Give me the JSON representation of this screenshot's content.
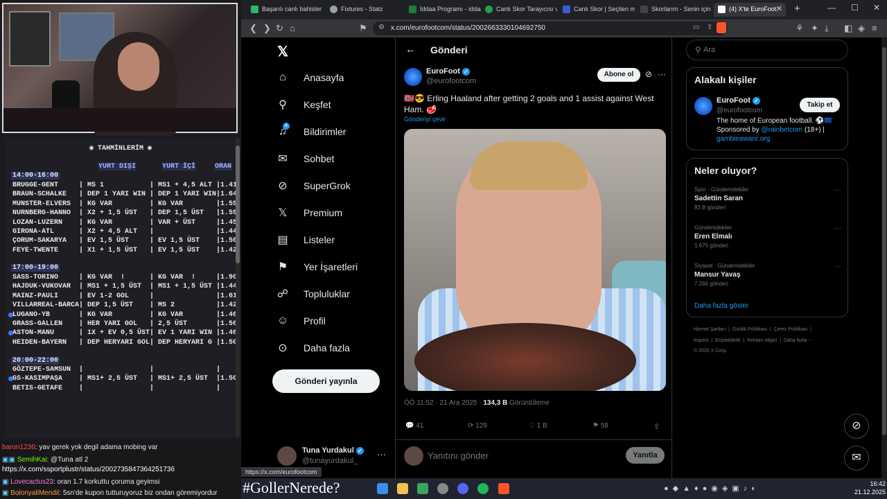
{
  "stream": {
    "panel_title": "TAHMİNLERİM",
    "col_yurt_disi": "YURT DIŞI",
    "col_yurt_ici": "YURT İÇİ",
    "col_oran": "ORAN",
    "slot1": "14:00-16:00",
    "slot2": "17:00-19:00",
    "slot3": "20:00-22:00",
    "rows1": [
      "BRUGGE-GENT     | MS 1           | MS1 + 4,5 ALT |1.41",
      "BRAUN-SCHALKE   | DEP 1 YARI WIN | DEP 1 YARI WIN|1.64",
      "MUNSTER-ELVERS  | KG VAR         | KG VAR        |1.59",
      "NURNBERG-HANNO  | X2 + 1,5 ÜST   | DEP 1,5 ÜST   |1.59",
      "LOZAN-LUZERN    | KG VAR         | VAR + ÜST     |1.45",
      "GIRONA-ATL      | X2 + 4,5 ALT   |               |1.44",
      "ÇORUM-SAKARYA   | EV 1,5 ÜST     | EV 1,5 ÜST    |1.50",
      "FEYE-TWENTE     | X1 + 1,5 ÜST   | EV 1,5 ÜST    |1.42"
    ],
    "rows2": [
      "SASS-TORINO     | KG VAR  !      | KG VAR  !     |1.90",
      "HAJDUK-VUKOVAR  | MS1 + 1,5 ÜST  | MS1 + 1,5 ÜST |1.44",
      "MAINZ-PAULI     | EV 1-2 GOL     |               |1.61",
      "VILLARREAL-BARCA| DEP 1,5 ÜST    | MS 2          |1.42",
      "LUGANO-YB       | KG VAR         | KG VAR        |1.46",
      "GRASS-GALLEN    | HER YARI GOL   | 2,5 ÜST       |1.56",
      "ASTON-MANU      | 1X + EV 0,5 ÜST| EV 1 YARI WIN |1.46",
      "HEIDEN-BAYERN   | DEP HERYARI GOL| DEP HERYARI G |1.50"
    ],
    "rows3": [
      "GÖZTEPE-SAMSUN  |                |               |",
      "GS-KASIMPAŞA    | MS1+ 2,5 ÜST   | MS1+ 2,5 ÜST  |1.50",
      "BETIS-GETAFE    |                |               |"
    ],
    "chat": [
      {
        "user": "baron1236",
        "msg": ": yav gerek yok degil adama mobing var",
        "color": "#ff4d4d"
      },
      {
        "user": "SemihKai",
        "msg": ": @Tuna atl 2",
        "color": "#7cfc00"
      },
      {
        "user": "",
        "msg": "https://x.com/ssportplustr/status/2002735847364251736",
        "color": "#ffffff"
      },
      {
        "user": "Lovecactus23",
        "msg": ": oran 1.7 korkuttu çoruma geyimsi",
        "color": "#ff7ad9"
      },
      {
        "user": "BolonyaliMendil",
        "msg": ": 5sn'de kupon tutturuyoruz biz ondan göremiyordur",
        "color": "#ff9a3c"
      }
    ]
  },
  "browser": {
    "tabs": [
      {
        "label": "Başarılı canlı bahisler iç",
        "color": "#2fb86a"
      },
      {
        "label": "Fixtures - Statz",
        "color": "#9aa0a6"
      },
      {
        "label": "İddaa Programı - iddaa",
        "color": "#1a7f37"
      },
      {
        "label": "Canlı Skor Tarayıcısı ve",
        "color": "#2a9d4a"
      },
      {
        "label": "Canlı Skor | Seçilen ma",
        "color": "#3a5bd9"
      },
      {
        "label": "Skorlarım - Senin için",
        "color": "#444"
      },
      {
        "label": "(4) X'te EuroFoot:",
        "color": "#fff"
      }
    ],
    "url": "x.com/eurofootcom/status/2002663330104692750",
    "status_url": "https://x.com/eurofootcom"
  },
  "nav": {
    "items": [
      {
        "label": "Anasayfa",
        "icon": "⌂"
      },
      {
        "label": "Keşfet",
        "icon": "⚲"
      },
      {
        "label": "Bildirimler",
        "icon": "🔔"
      },
      {
        "label": "Sohbet",
        "icon": "✉"
      },
      {
        "label": "SuperGrok",
        "icon": "⊘"
      },
      {
        "label": "Premium",
        "icon": "X"
      },
      {
        "label": "Listeler",
        "icon": "▤"
      },
      {
        "label": "Yer İşaretleri",
        "icon": "⚑"
      },
      {
        "label": "Topluluklar",
        "icon": "👥"
      },
      {
        "label": "Profil",
        "icon": "👤"
      },
      {
        "label": "Daha fazla",
        "icon": "⊙"
      }
    ],
    "notif_count": "4",
    "post_button": "Gönderi yayınla",
    "user_name": "Tuna Yurdakul",
    "user_handle": "@tunayurdakul_"
  },
  "post": {
    "header": "Gönderi",
    "author": "EuroFoot",
    "handle": "@eurofootcom",
    "follow": "Abone ol",
    "text": "🇳🇴😎 Erling Haaland after getting 2 goals and 1 assist against West Ham. 🥩",
    "translate": "Gönderiyi çevir",
    "time": "ÖÖ 11:52 · 21 Ara 2025 ·",
    "views": "134,3 B",
    "views_label": "Görüntüleme",
    "replies": "41",
    "reposts": "129",
    "likes": "1 B",
    "bookmarks": "58",
    "reply_placeholder": "Yanıtını gönder",
    "reply_btn": "Yanıtla"
  },
  "sidebar": {
    "search": "Ara",
    "related_title": "Alakalı kişiler",
    "related_name": "EuroFoot",
    "related_handle": "@eurofootcom",
    "related_follow": "Takip et",
    "bio1": "The home of European football. ⚽🇪🇺",
    "bio2a": "Sponsored by ",
    "bio2b": "@rainbetcom",
    "bio2c": " (18+) |",
    "bio3": "gambleaware.org",
    "trends_title": "Neler oluyor?",
    "trends": [
      {
        "cat": "Spor · Gündemdekiler",
        "name": "Sadettin Saran",
        "count": "83 B gönderi"
      },
      {
        "cat": "Gündemdekiler",
        "name": "Eren Elmalı",
        "count": "1.675 gönderi"
      },
      {
        "cat": "Siyaset · Gündemdekiler",
        "name": "Mansur Yavaş",
        "count": "7.266 gönderi"
      }
    ],
    "more": "Daha fazla göster",
    "footer1": "Hizmet Şartları  |  Gizlilik Politikası  |  Çerez Politikası  |",
    "footer2": "Imprint  |  Erişilebilirlik  |  Reklam bilgisi  |  Daha fazla ···",
    "footer3": "© 2025 X Corp."
  },
  "taskbar": {
    "hashtag": "#GollerNerede?",
    "time": "16:42",
    "date": "21.12.2025"
  }
}
